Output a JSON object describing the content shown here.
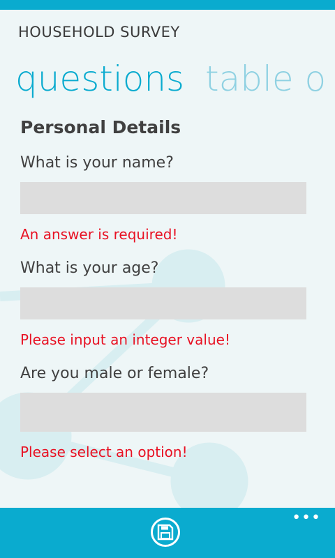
{
  "app": {
    "title": "HOUSEHOLD SURVEY"
  },
  "pivot": {
    "tabs": [
      {
        "label": "questions"
      },
      {
        "label": "table o"
      }
    ]
  },
  "section": {
    "title": "Personal Details"
  },
  "questions": [
    {
      "label": "What is your name?",
      "value": "",
      "error": "An answer is required!"
    },
    {
      "label": "What is your age?",
      "value": "",
      "error": "Please input an integer value!"
    },
    {
      "label": "Are you male or female?",
      "value": "",
      "error": "Please select an option!"
    }
  ],
  "appbar": {
    "more": "•••",
    "save_icon": "save-icon"
  },
  "colors": {
    "accent": "#0aabcf",
    "error": "#e81123",
    "field": "#dddddd"
  }
}
